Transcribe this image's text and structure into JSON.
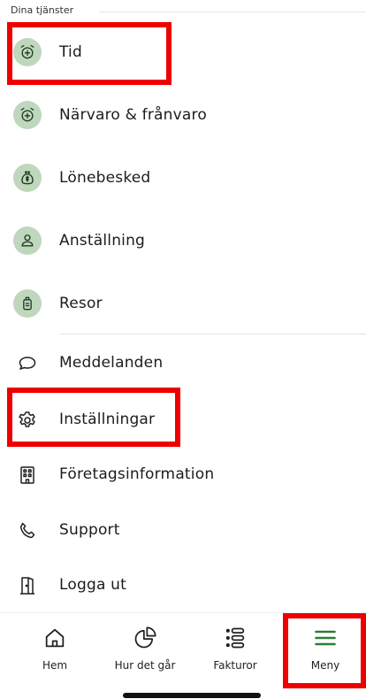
{
  "section": {
    "label": "Dina tjänster"
  },
  "services": [
    {
      "label": "Tid",
      "icon": "alarm-clock-plus-icon"
    },
    {
      "label": "Närvaro & frånvaro",
      "icon": "alarm-clock-plus-icon"
    },
    {
      "label": "Lönebesked",
      "icon": "money-bag-icon"
    },
    {
      "label": "Anställning",
      "icon": "person-icon"
    },
    {
      "label": "Resor",
      "icon": "luggage-icon"
    }
  ],
  "menu": [
    {
      "label": "Meddelanden",
      "icon": "chat-bubble-icon"
    },
    {
      "label": "Inställningar",
      "icon": "gear-icon"
    },
    {
      "label": "Företagsinformation",
      "icon": "building-icon"
    },
    {
      "label": "Support",
      "icon": "phone-icon"
    },
    {
      "label": "Logga ut",
      "icon": "door-exit-icon"
    }
  ],
  "bottom_nav": [
    {
      "label": "Hem",
      "icon": "home-icon"
    },
    {
      "label": "Hur det går",
      "icon": "pie-chart-icon"
    },
    {
      "label": "Fakturor",
      "icon": "list-icon"
    },
    {
      "label": "Meny",
      "icon": "menu-icon",
      "active": true
    }
  ],
  "colors": {
    "accent_green": "#2e7d3a",
    "icon_circle": "#bfd7bd",
    "highlight": "#ee0000"
  }
}
